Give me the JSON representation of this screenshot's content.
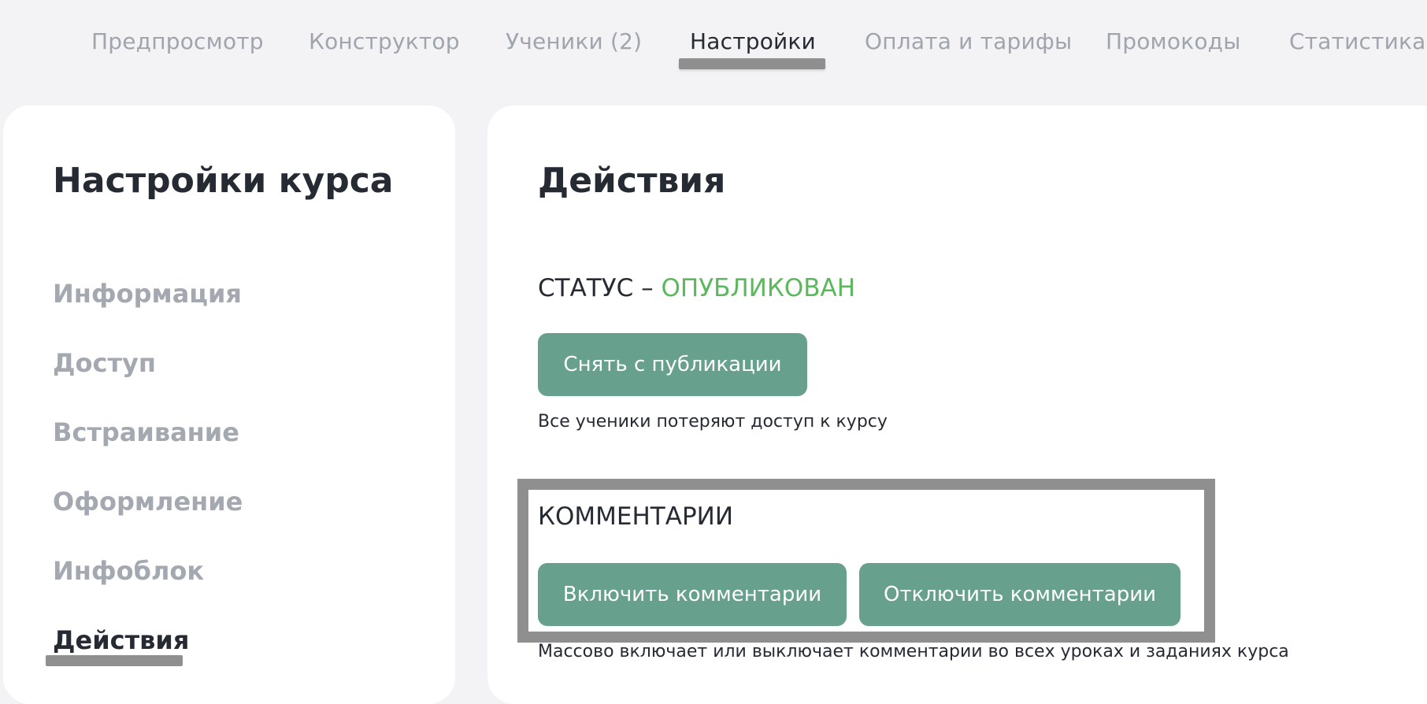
{
  "tabs": [
    {
      "label": "Предпросмотр",
      "active": false
    },
    {
      "label": "Конструктор",
      "active": false
    },
    {
      "label": "Ученики (2)",
      "active": false
    },
    {
      "label": "Настройки",
      "active": true
    },
    {
      "label": "Оплата и тарифы",
      "active": false
    },
    {
      "label": "Промокоды",
      "active": false
    },
    {
      "label": "Статистика",
      "active": false
    }
  ],
  "sidebar": {
    "title": "Настройки курса",
    "items": [
      {
        "label": "Информация",
        "active": false
      },
      {
        "label": "Доступ",
        "active": false
      },
      {
        "label": "Встраивание",
        "active": false
      },
      {
        "label": "Оформление",
        "active": false
      },
      {
        "label": "Инфоблок",
        "active": false
      },
      {
        "label": "Действия",
        "active": true
      }
    ]
  },
  "main": {
    "title": "Действия",
    "status": {
      "label": "СТАТУС –",
      "value": "ОПУБЛИКОВАН",
      "value_color": "#5cb85c"
    },
    "unpublish_button": "Снять с публикации",
    "unpublish_hint": "Все ученики потеряют доступ к курсу",
    "comments": {
      "title": "КОММЕНТАРИИ",
      "enable_button": "Включить комментарии",
      "disable_button": "Отключить комментарии",
      "hint": "Массово включает или выключает комментарии во всех уроках и заданиях курса"
    }
  },
  "colors": {
    "accent_button": "#67a08c",
    "background": "#f3f3f5",
    "text_primary": "#262a33",
    "text_muted": "#a4a8b0",
    "status_green": "#5cb85c"
  }
}
